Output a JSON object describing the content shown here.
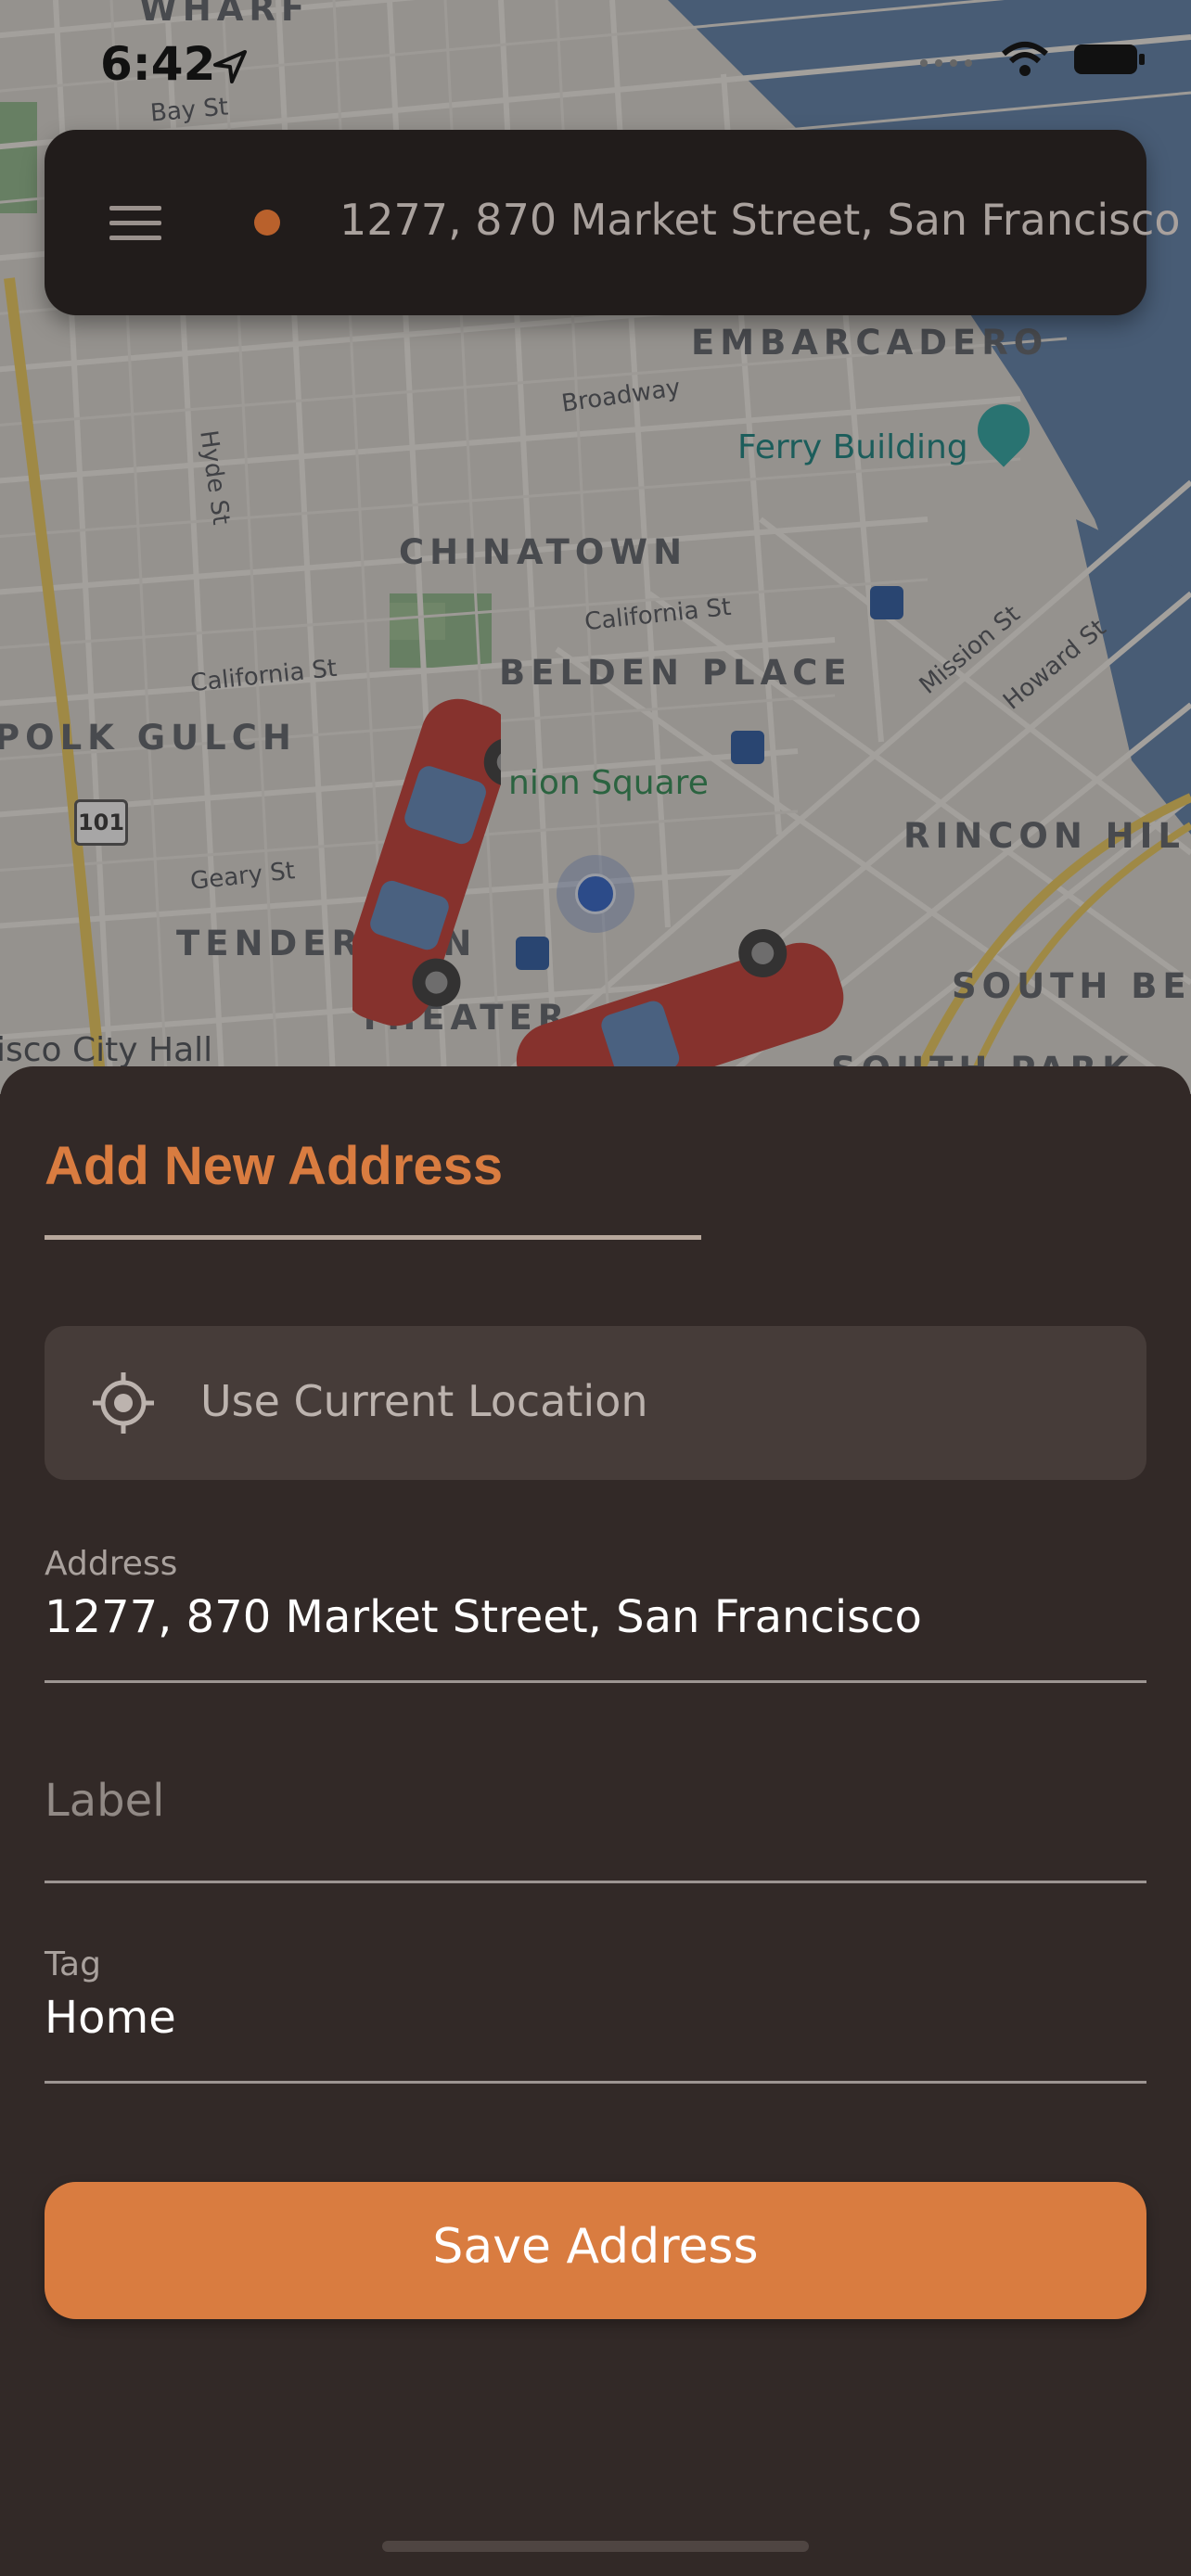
{
  "status_bar": {
    "time": "6:42"
  },
  "map": {
    "districts": [
      "WHARF",
      "EMBARCADERO",
      "CHINATOWN",
      "BELDEN PLACE",
      "POLK GULCH",
      "TENDERLOIN",
      "THEATER",
      "RINCON HIL",
      "SOUTH BE",
      "SOUTH PARK"
    ],
    "streets": [
      "Bay St",
      "Broadway",
      "Hyde St",
      "California St",
      "California St",
      "Geary St",
      "Mission St",
      "Howard St"
    ],
    "pois": {
      "ferry_building": "Ferry Building",
      "union_square": "nion Square",
      "city_hall": "isco City Hall",
      "highway_shield": "101"
    }
  },
  "search_bar": {
    "address": "1277, 870 Market Street, San Francisco"
  },
  "sheet": {
    "title": "Add New Address",
    "use_location": "Use Current Location",
    "address_label": "Address",
    "address_value": "1277, 870 Market Street, San Francisco",
    "label_placeholder": "Label",
    "tag_label": "Tag",
    "tag_value": "Home",
    "save_button": "Save Address"
  },
  "colors": {
    "accent": "#d97c40",
    "sheet_bg": "#322927",
    "field_bg": "#463c39"
  }
}
